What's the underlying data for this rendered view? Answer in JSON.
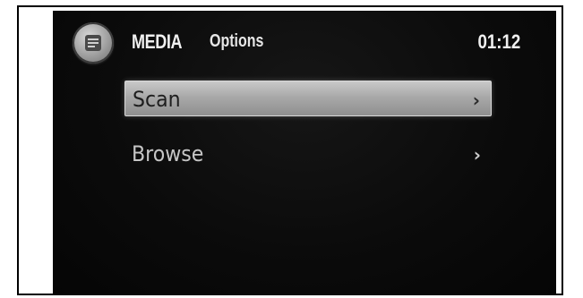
{
  "header": {
    "icon": "media-source-icon",
    "title": "MEDIA",
    "subtitle": "Options",
    "clock": "01:12"
  },
  "menu": {
    "items": [
      {
        "label": "Scan",
        "icon": "chevron-right-icon",
        "selected": true
      },
      {
        "label": "Browse",
        "icon": "chevron-right-icon",
        "selected": false
      }
    ]
  },
  "colors": {
    "background": "#0b0b0b",
    "highlight": "#b0b0b0",
    "text": "#f0f0f0"
  }
}
